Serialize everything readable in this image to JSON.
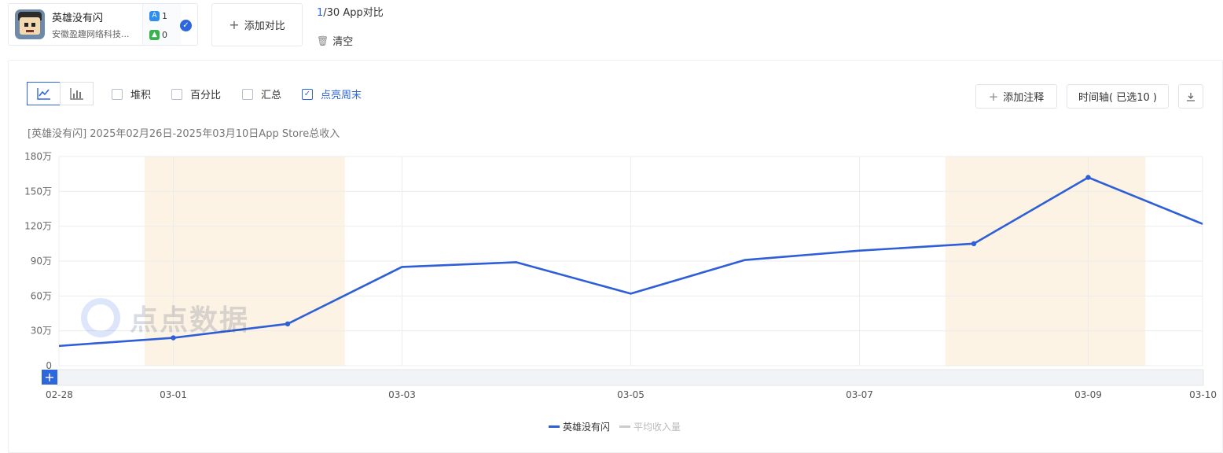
{
  "app": {
    "name": "英雄没有闪",
    "developer": "安徽盈趣网络科技...",
    "ios_count": "1",
    "android_count": "0"
  },
  "compare": {
    "add_label": "添加对比",
    "count_current": "1",
    "count_rest": "/30 App对比",
    "clear_label": "清空"
  },
  "options": {
    "stack": "堆积",
    "percent": "百分比",
    "summary": "汇总",
    "highlight_weekend": "点亮周末"
  },
  "toolbar": {
    "add_note": "添加注释",
    "timeline": "时间轴( 已选10 )"
  },
  "subtitle": "[英雄没有闪] 2025年02月26日-2025年03月10日App Store总收入",
  "watermark": "点点数据",
  "colors": {
    "accent": "#2e66de",
    "weekend": "#fdf3e4",
    "series_main": "#2e5fd8",
    "series_avg": "#cccccc"
  },
  "chart_data": {
    "type": "line",
    "ylim": [
      0,
      1800000
    ],
    "y_ticks": [
      {
        "value": 0,
        "label": "0"
      },
      {
        "value": 300000,
        "label": "30万"
      },
      {
        "value": 600000,
        "label": "60万"
      },
      {
        "value": 900000,
        "label": "90万"
      },
      {
        "value": 1200000,
        "label": "120万"
      },
      {
        "value": 1500000,
        "label": "150万"
      },
      {
        "value": 1800000,
        "label": "180万"
      }
    ],
    "x_range": [
      "02-28",
      "03-10"
    ],
    "x_ticks": [
      "02-28",
      "03-01",
      "03-03",
      "03-05",
      "03-07",
      "03-09",
      "03-10"
    ],
    "weekend_bands": [
      [
        "02-28T18",
        "03-02T12"
      ],
      [
        "03-07T18",
        "03-09T12"
      ]
    ],
    "grid": true,
    "legend_position": "bottom",
    "series": [
      {
        "name": "英雄没有闪",
        "points": [
          {
            "x": "02-28",
            "y": 170000
          },
          {
            "x": "03-01",
            "y": 240000,
            "marker": true
          },
          {
            "x": "03-02",
            "y": 360000,
            "marker": true
          },
          {
            "x": "03-03",
            "y": 850000
          },
          {
            "x": "03-04",
            "y": 890000
          },
          {
            "x": "03-05",
            "y": 620000
          },
          {
            "x": "03-06",
            "y": 910000
          },
          {
            "x": "03-07",
            "y": 990000
          },
          {
            "x": "03-08",
            "y": 1050000,
            "marker": true
          },
          {
            "x": "03-09",
            "y": 1620000,
            "marker": true
          },
          {
            "x": "03-10",
            "y": 1220000
          }
        ]
      }
    ],
    "legend_extra": "平均收入量"
  }
}
